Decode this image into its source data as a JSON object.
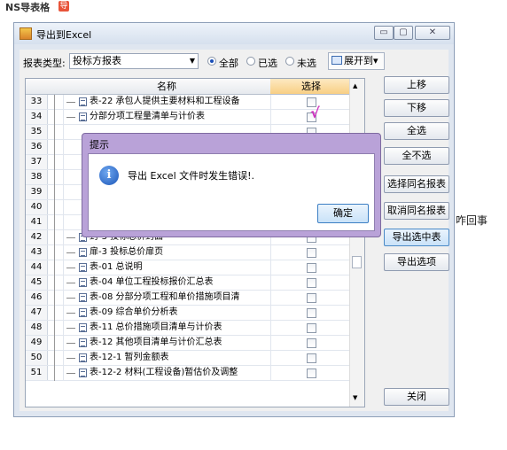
{
  "page": {
    "top_text": "NS导表格",
    "top_badge": "导",
    "side_text": "咋回事"
  },
  "window": {
    "title": "导出到Excel",
    "controls": {
      "minimize": "▭",
      "maximize": "▢",
      "close": "✕"
    }
  },
  "toolbar": {
    "type_label": "报表类型:",
    "type_value": "投标方报表",
    "radios": [
      {
        "label": "全部",
        "checked": true
      },
      {
        "label": "已选",
        "checked": false
      },
      {
        "label": "未选",
        "checked": false
      }
    ],
    "expand_label": "展开到",
    "expand_arrow": "▾"
  },
  "table": {
    "col_name": "名称",
    "col_select": "选择",
    "rows": [
      {
        "num": "33",
        "name": "表-22 承包人提供主要材料和工程设备"
      },
      {
        "num": "34",
        "name": "分部分项工程量清单与计价表"
      },
      {
        "num": "35",
        "name": ""
      },
      {
        "num": "36",
        "name": ""
      },
      {
        "num": "37",
        "name": ""
      },
      {
        "num": "38",
        "name": ""
      },
      {
        "num": "39",
        "name": ""
      },
      {
        "num": "40",
        "name": ""
      },
      {
        "num": "41",
        "name": ""
      },
      {
        "num": "42",
        "name": "封-3 投标总价封面"
      },
      {
        "num": "43",
        "name": "扉-3 投标总价扉页"
      },
      {
        "num": "44",
        "name": "表-01 总说明"
      },
      {
        "num": "45",
        "name": "表-04 单位工程投标报价汇总表"
      },
      {
        "num": "46",
        "name": "表-08 分部分项工程和单价措施项目清"
      },
      {
        "num": "47",
        "name": "表-09 综合单价分析表"
      },
      {
        "num": "48",
        "name": "表-11 总价措施项目清单与计价表"
      },
      {
        "num": "49",
        "name": "表-12 其他项目清单与计价汇总表"
      },
      {
        "num": "50",
        "name": "表-12-1 暂列金额表"
      },
      {
        "num": "51",
        "name": "表-12-2 材料(工程设备)暂估价及调整"
      }
    ]
  },
  "buttons": {
    "up": "上移",
    "down": "下移",
    "select_all": "全选",
    "select_none": "全不选",
    "select_same": "选择同名报表",
    "cancel_same": "取消同名报表",
    "export_selected": "导出选中表",
    "export_options": "导出选项",
    "close": "关闭"
  },
  "dialog": {
    "title": "提示",
    "icon": "i",
    "message": "导出 Excel 文件时发生错误!.",
    "ok": "确定"
  },
  "annotation": {
    "mark": "√",
    "color": "#d030c0"
  }
}
